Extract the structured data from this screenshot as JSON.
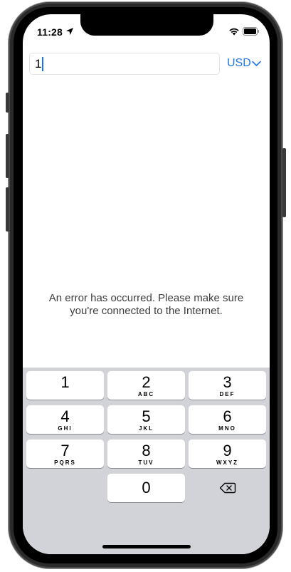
{
  "status_bar": {
    "time": "11:28",
    "icons": [
      "location-arrow-icon",
      "wifi-icon",
      "battery-icon"
    ]
  },
  "amount_input": {
    "value": "1"
  },
  "currency_picker": {
    "label": "USD",
    "icon": "chevron-down-icon"
  },
  "error": {
    "line1": "An error has occurred. Please make sure",
    "line2": "you're connected to the Internet."
  },
  "keypad": {
    "keys": [
      {
        "digit": "1",
        "letters": ""
      },
      {
        "digit": "2",
        "letters": "ABC"
      },
      {
        "digit": "3",
        "letters": "DEF"
      },
      {
        "digit": "4",
        "letters": "GHI"
      },
      {
        "digit": "5",
        "letters": "JKL"
      },
      {
        "digit": "6",
        "letters": "MNO"
      },
      {
        "digit": "7",
        "letters": "PQRS"
      },
      {
        "digit": "8",
        "letters": "TUV"
      },
      {
        "digit": "9",
        "letters": "WXYZ"
      },
      {
        "digit": "0",
        "letters": ""
      }
    ],
    "delete_icon": "backspace-icon"
  },
  "colors": {
    "accent": "#1e78e6",
    "keyboard_bg": "#d2d3d8",
    "key_bg": "#ffffff",
    "error_text": "#3c3c3c"
  }
}
